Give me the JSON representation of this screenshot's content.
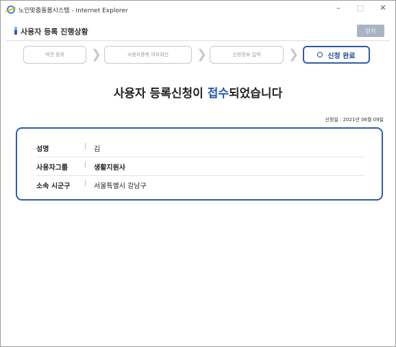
{
  "window": {
    "title": "노인맞춤돌봄시스템 - Internet Explorer",
    "minimize": "–",
    "maximize": "□",
    "close": "✕"
  },
  "header": {
    "title": "사용자 등록 진행상황",
    "close_label": "닫기"
  },
  "steps": [
    {
      "label": "약관 동의",
      "active": false
    },
    {
      "label": "사용자중복 여부확인",
      "active": false
    },
    {
      "label": "신청정보 입력",
      "active": false
    },
    {
      "label": "신청 완료",
      "active": true
    }
  ],
  "headline": {
    "before": "사용자 등록신청이 ",
    "accent": "접수",
    "after": "되었습니다"
  },
  "date": {
    "text": "신청일 : 2021년 06월 09일"
  },
  "info": [
    {
      "label": "성명",
      "value": "김"
    },
    {
      "label": "사용자그룹",
      "value": "생활지원사"
    },
    {
      "label": "소속 시군구",
      "value": "서울특별시 강남구"
    }
  ],
  "colors": {
    "accent": "#2457b0",
    "border": "#2e5aa8",
    "close_button": "#a9b4c2"
  },
  "icons": [
    "ie-icon",
    "header-icon",
    "ring-icon",
    "chevron-right-icon"
  ]
}
